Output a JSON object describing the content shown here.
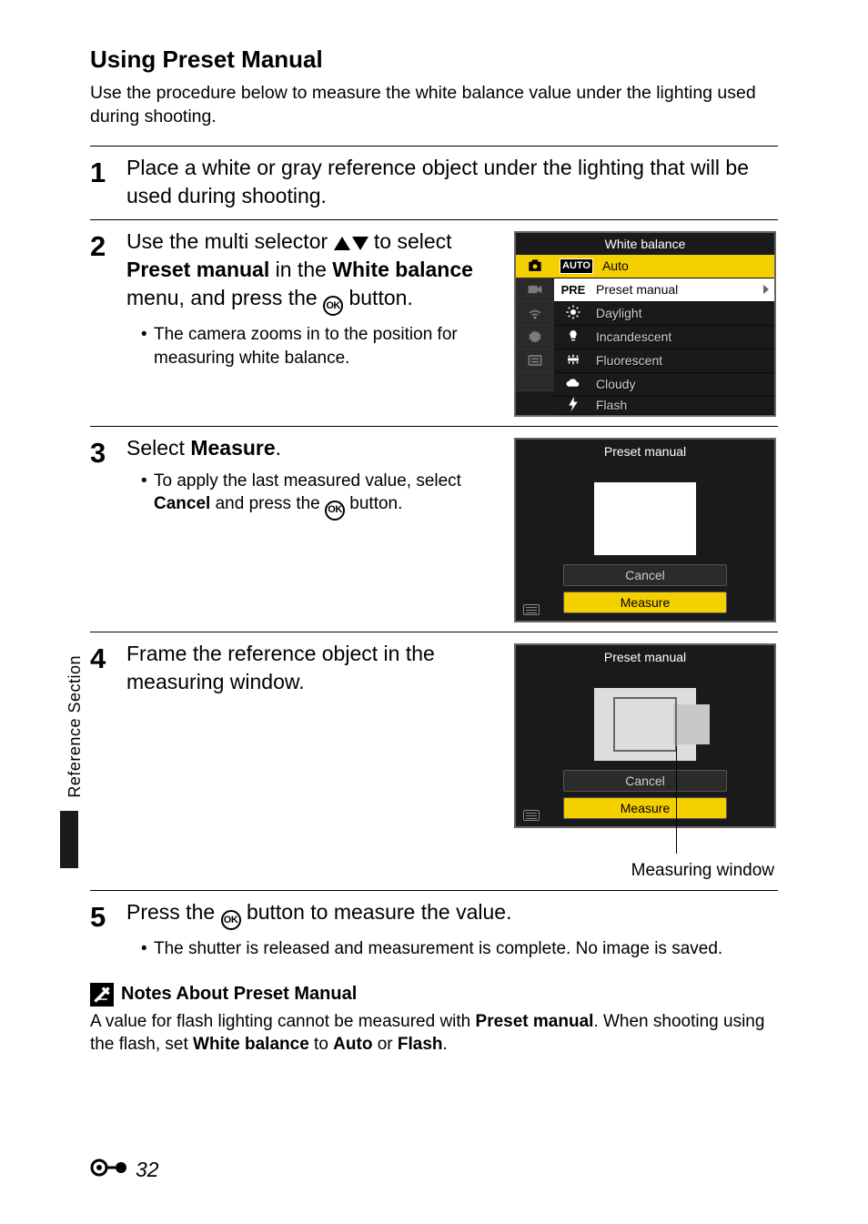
{
  "sideTab": "Reference Section",
  "sectionTitle": "Using Preset Manual",
  "intro": "Use the procedure below to measure the white balance value under the lighting used during shooting.",
  "steps": {
    "s1": {
      "num": "1",
      "heading": "Place a white or gray reference object under the lighting that will be used during shooting."
    },
    "s2": {
      "num": "2",
      "heading_a": "Use the multi selector ",
      "heading_b": " to select ",
      "heading_bold1": "Preset manual",
      "heading_c": " in the ",
      "heading_bold2": "White balance",
      "heading_d": " menu, and press the ",
      "heading_e": " button.",
      "bullet": "The camera zooms in to the position for measuring white balance."
    },
    "s3": {
      "num": "3",
      "heading_a": "Select ",
      "heading_bold": "Measure",
      "heading_b": ".",
      "bullet_a": "To apply the last measured value, select ",
      "bullet_bold": "Cancel",
      "bullet_b": " and press the ",
      "bullet_c": " button."
    },
    "s4": {
      "num": "4",
      "heading": "Frame the reference object in the measuring window.",
      "caption": "Measuring window"
    },
    "s5": {
      "num": "5",
      "heading_a": "Press the ",
      "heading_b": " button to measure the value.",
      "bullet": "The shutter is released and measurement is complete. No image is saved."
    }
  },
  "screen1": {
    "title": "White balance",
    "rows": {
      "auto": "Auto",
      "preset": "Preset manual",
      "daylight": "Daylight",
      "incandescent": "Incandescent",
      "fluorescent": "Fluorescent",
      "cloudy": "Cloudy",
      "flash": "Flash"
    },
    "icons": {
      "auto": "AUTO",
      "pre": "PRE"
    }
  },
  "screen2": {
    "title": "Preset manual",
    "cancel": "Cancel",
    "measure": "Measure"
  },
  "screen3": {
    "title": "Preset manual",
    "cancel": "Cancel",
    "measure": "Measure"
  },
  "notes": {
    "heading": "Notes About Preset Manual",
    "text_a": "A value for flash lighting cannot be measured with ",
    "text_bold1": "Preset manual",
    "text_b": ". When shooting using the flash, set ",
    "text_bold2": "White balance",
    "text_c": " to ",
    "text_bold3": "Auto",
    "text_d": " or ",
    "text_bold4": "Flash",
    "text_e": "."
  },
  "pageNum": "32"
}
